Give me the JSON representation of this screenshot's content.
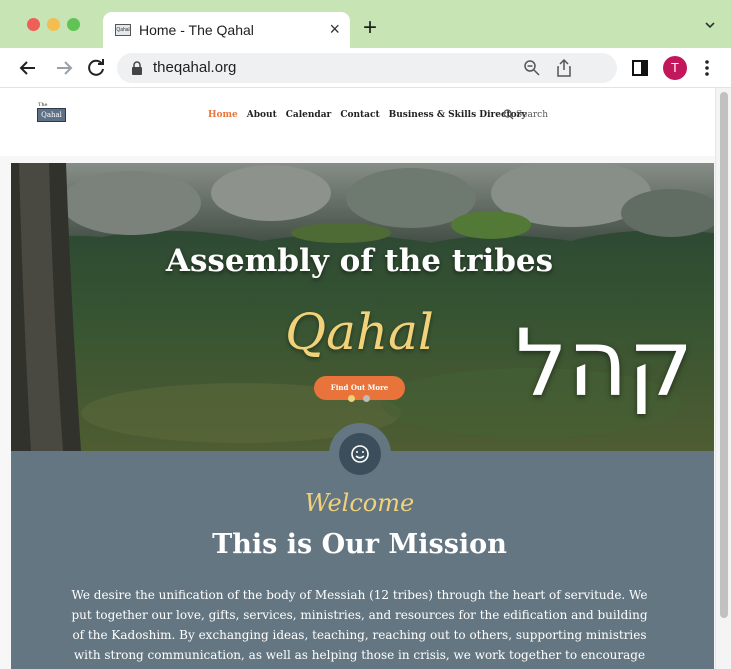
{
  "browser": {
    "tab_title": "Home - The Qahal",
    "tab_favicon_text": "Qahal",
    "tab_close": "×",
    "new_tab": "+",
    "url": "theqahal.org",
    "profile_initial": "T",
    "tabbar_color": "#c7e5b4"
  },
  "site": {
    "logo_top": "The",
    "logo_main": "Qahal",
    "menu": [
      {
        "label": "Home",
        "active": true
      },
      {
        "label": "About",
        "active": false
      },
      {
        "label": "Calendar",
        "active": false
      },
      {
        "label": "Contact",
        "active": false
      },
      {
        "label": "Business & Skills Directory",
        "active": false
      }
    ],
    "search_placeholder": "Search",
    "accent_color": "#e8743b"
  },
  "hero": {
    "title": "Assembly of the tribes",
    "script_title": "Qahal",
    "hebrew": "קהל",
    "cta_label": "Find Out More",
    "slides": 2,
    "active_slide": 1
  },
  "mission": {
    "welcome": "Welcome",
    "title": "This is Our Mission",
    "body": "We desire the unification of the body of Messiah (12 tribes) through the heart of servitude. We put together our love, gifts, services, ministries, and resources for the edification and building of the Kadoshim. By exchanging ideas, teaching, reaching out to others, supporting ministries with strong communication, as well as helping those in crisis, we work together to encourage and support the scattered body.",
    "background_color": "#647681"
  }
}
